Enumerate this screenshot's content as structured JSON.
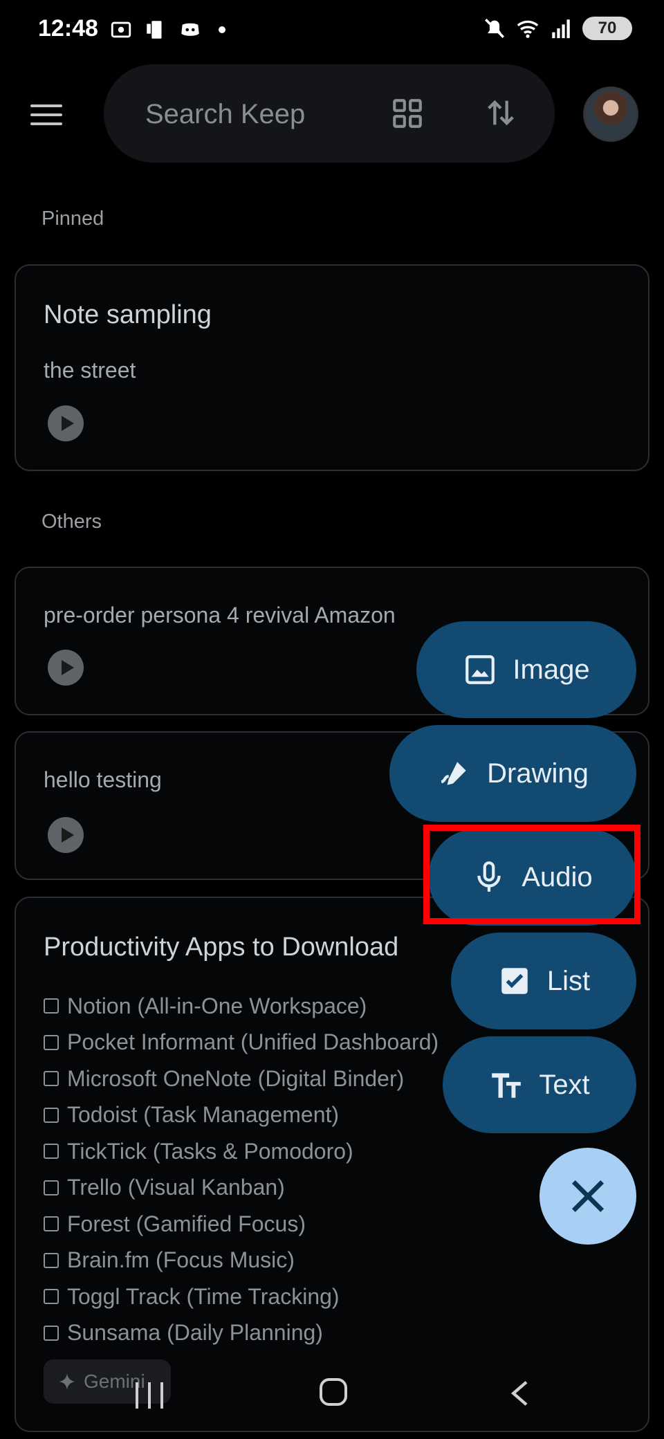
{
  "status_bar": {
    "time": "12:48",
    "battery": "70"
  },
  "header": {
    "search_placeholder": "Search Keep"
  },
  "sections": {
    "pinned": "Pinned",
    "others": "Others"
  },
  "pinned_note": {
    "title": "Note sampling",
    "text": "the street"
  },
  "notes": [
    {
      "text": "pre-order persona 4 revival Amazon"
    },
    {
      "text": "hello testing"
    }
  ],
  "list_note": {
    "title": "Productivity Apps to Download",
    "items": [
      "Notion (All-in-One Workspace)",
      "Pocket Informant (Unified Dashboard)",
      "Microsoft OneNote (Digital Binder)",
      "Todoist (Task Management)",
      "TickTick (Tasks & Pomodoro)",
      "Trello (Visual Kanban)",
      "Forest (Gamified Focus)",
      "Brain.fm (Focus Music)",
      "Toggl Track (Time Tracking)",
      "Sunsama (Daily Planning)"
    ],
    "chip": "Gemini"
  },
  "fab_menu": {
    "image": "Image",
    "drawing": "Drawing",
    "audio": "Audio",
    "list": "List",
    "text": "Text"
  },
  "colors": {
    "fab_bg": "#134a72",
    "close_bg": "#a8d0f5",
    "highlight": "#ff0000"
  }
}
